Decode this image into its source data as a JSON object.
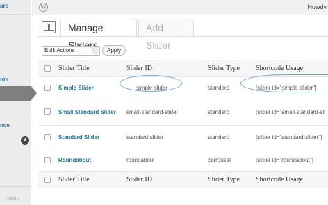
{
  "sidebar": {
    "items": [
      {
        "label": "ard",
        "color": "#21759b"
      },
      {
        "label": "nts",
        "color": "#21759b"
      },
      {
        "label": "nce",
        "color": "#21759b"
      }
    ],
    "badge": "3",
    "collapse_label": "menu"
  },
  "adminbar": {
    "logo": "W",
    "howdy": "Howdy"
  },
  "tabs": {
    "active": "Manage Sliders",
    "inactive": "Add Slider"
  },
  "bulk": {
    "select_value": "Bulk Actions",
    "apply_label": "Apply"
  },
  "table": {
    "headers": [
      "Slider Title",
      "Slider ID",
      "Slider Type",
      "Shortcode Usage"
    ],
    "rows": [
      {
        "title": "Simple Slider",
        "id": "simple-slider",
        "type": "standard",
        "shortcode": "[slider id=\"simple-slider\"]"
      },
      {
        "title": "Small Standard Slider",
        "id": "small-standard-slider",
        "type": "standard",
        "shortcode": "[slider id=\"small-standard-sli"
      },
      {
        "title": "Standard Slider",
        "id": "standard-slider",
        "type": "standard",
        "shortcode": "[slider id=\"standard-slider\"]"
      },
      {
        "title": "Roundabout",
        "id": "roundabout",
        "type": "carrousel",
        "shortcode": "[slider id=\"roundabout\"]"
      }
    ],
    "footers": [
      "Slider Title",
      "Slider ID",
      "Slider Type",
      "Shortcode Usage"
    ]
  },
  "colors": {
    "link": "#21759b",
    "highlight_ellipse": "#6aa7cf",
    "active_menu": "#7f7f7f"
  }
}
